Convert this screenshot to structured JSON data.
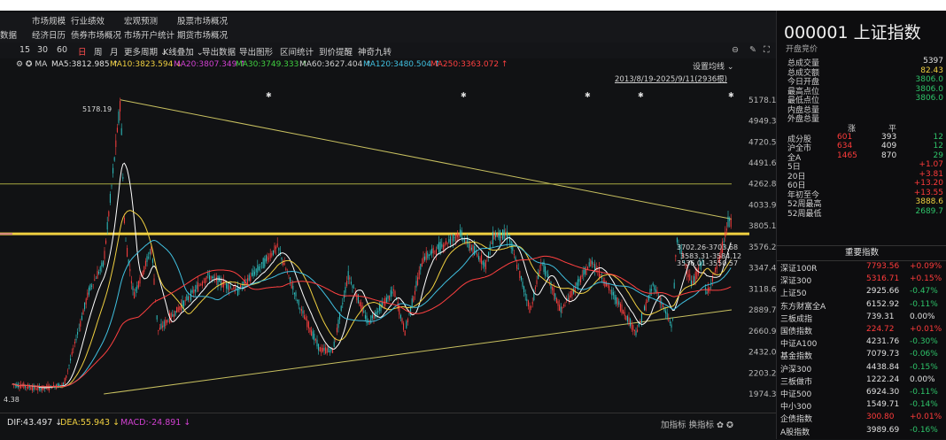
{
  "menu": {
    "row1": [
      "市场规模",
      "行业绩效",
      "宏观预测",
      "股票市场概况"
    ],
    "row2": [
      "数据",
      "经济日历",
      "债券市场概况",
      "市场开户统计",
      "期货市场概况"
    ]
  },
  "toolbar": {
    "items": [
      "15",
      "30",
      "60",
      "日",
      "周",
      "月",
      "更多周期 ⌄",
      "K线叠加 ⌄",
      "导出数据",
      "导出图形",
      "区间统计",
      "到价提醒",
      "神奇九转"
    ],
    "active_index": 3
  },
  "ma_bar": {
    "prefix": "⚙ ✪ MA",
    "items": [
      {
        "label": "MA5:3812.985 ↑",
        "color": "#e0e0e0"
      },
      {
        "label": "MA10:3823.594 ↓",
        "color": "#f0d040"
      },
      {
        "label": "MA20:3807.349 ↑",
        "color": "#d040d0"
      },
      {
        "label": "MA30:3749.333 ↑",
        "color": "#40d040"
      },
      {
        "label": "MA60:3627.404 ↑",
        "color": "#d0d0d0"
      },
      {
        "label": "MA120:3480.504 ↑",
        "color": "#40c0e0"
      },
      {
        "label": "MA250:3363.072 ↑",
        "color": "#ff4040"
      }
    ],
    "setting_label": "设置均线 ⌄"
  },
  "date_range": "2013/8/19-2025/9/11(2936根)",
  "chart_data": {
    "type": "line",
    "series_type": "candlestick",
    "y_ticks": [
      "5178.19",
      "4949.35",
      "4720.50",
      "4491.66",
      "4262.82",
      "4033.97",
      "3805.13",
      "3576.29",
      "3347.44",
      "3118.60",
      "2889.75",
      "2660.91",
      "2432.07",
      "2203.22",
      "1974.38"
    ],
    "ylim": [
      1849,
      5263
    ],
    "annotations": [
      "5178.19",
      "3702.26-3703.68",
      "3583.31-3584.12",
      "3536.01-3550.57",
      "4.38"
    ],
    "trend_lines": {
      "upper": [
        {
          "date": "2015-06-12",
          "y": 5178.19
        },
        {
          "date": "2025-09-11",
          "y": 3880
        }
      ],
      "lower": [
        {
          "date": "2015-03-02",
          "y": 1974.38
        },
        {
          "date": "2025-09-11",
          "y": 2890
        }
      ],
      "h1": 4262.82,
      "h2": 3719
    },
    "close_series_sketch": [
      {
        "date": "2013-08-19",
        "y": 2080
      },
      {
        "date": "2014-02-01",
        "y": 2030
      },
      {
        "date": "2014-07-01",
        "y": 2080
      },
      {
        "date": "2014-12-01",
        "y": 3100
      },
      {
        "date": "2015-03-01",
        "y": 3400
      },
      {
        "date": "2015-06-12",
        "y": 5170
      },
      {
        "date": "2015-07-09",
        "y": 3700
      },
      {
        "date": "2015-09-01",
        "y": 3050
      },
      {
        "date": "2015-12-20",
        "y": 3560
      },
      {
        "date": "2016-01-28",
        "y": 2660
      },
      {
        "date": "2016-06-01",
        "y": 2900
      },
      {
        "date": "2016-11-28",
        "y": 3260
      },
      {
        "date": "2017-06-01",
        "y": 3100
      },
      {
        "date": "2017-11-14",
        "y": 3420
      },
      {
        "date": "2018-01-29",
        "y": 3580
      },
      {
        "date": "2018-06-20",
        "y": 2900
      },
      {
        "date": "2018-10-18",
        "y": 2450
      },
      {
        "date": "2019-01-03",
        "y": 2450
      },
      {
        "date": "2019-04-08",
        "y": 3270
      },
      {
        "date": "2019-08-06",
        "y": 2750
      },
      {
        "date": "2020-01-14",
        "y": 3100
      },
      {
        "date": "2020-03-19",
        "y": 2650
      },
      {
        "date": "2020-07-09",
        "y": 3450
      },
      {
        "date": "2021-02-18",
        "y": 3720
      },
      {
        "date": "2021-07-27",
        "y": 3380
      },
      {
        "date": "2021-09-14",
        "y": 3710
      },
      {
        "date": "2021-12-13",
        "y": 3700
      },
      {
        "date": "2022-04-27",
        "y": 2880
      },
      {
        "date": "2022-07-05",
        "y": 3420
      },
      {
        "date": "2022-10-31",
        "y": 2880
      },
      {
        "date": "2023-05-09",
        "y": 3420
      },
      {
        "date": "2023-10-23",
        "y": 2950
      },
      {
        "date": "2024-02-05",
        "y": 2640
      },
      {
        "date": "2024-05-20",
        "y": 3170
      },
      {
        "date": "2024-09-13",
        "y": 2690
      },
      {
        "date": "2024-10-08",
        "y": 3670
      },
      {
        "date": "2025-01-13",
        "y": 3160
      },
      {
        "date": "2025-03-18",
        "y": 3440
      },
      {
        "date": "2025-04-07",
        "y": 3040
      },
      {
        "date": "2025-07-01",
        "y": 3450
      },
      {
        "date": "2025-08-25",
        "y": 3880
      },
      {
        "date": "2025-09-11",
        "y": 3806
      }
    ]
  },
  "macd": {
    "dif": "DIF:43.497 ↓",
    "dea": "DEA:55.943 ↓",
    "macd": "MACD:-24.891 ↓",
    "right_label": "加指标 换指标 ✿ ✪",
    "dif_color": "#e0e0e0",
    "dea_color": "#f0d040",
    "macd_color": "#d040d0"
  },
  "quote": {
    "title": "000001 上证指数",
    "subtitle": "开盘竞价",
    "rows": [
      {
        "label": "总成交量",
        "value": "5397",
        "color": "white"
      },
      {
        "label": "总成交额",
        "value": "82.43",
        "color": "yellow"
      },
      {
        "label": "今日开盘",
        "value": "3806.0",
        "color": "green"
      },
      {
        "label": "最高点位",
        "value": "3806.0",
        "color": "green"
      },
      {
        "label": "最低点位",
        "value": "3806.0",
        "color": "green"
      },
      {
        "label": "内盘总量",
        "value": "",
        "color": "white"
      },
      {
        "label": "外盘总量",
        "value": "",
        "color": "white"
      }
    ],
    "breadth_headers": [
      "涨",
      "平"
    ],
    "breadth": [
      {
        "label": "成分股",
        "up": "601",
        "flat": "393",
        "down": "12"
      },
      {
        "label": "沪全市",
        "up": "634",
        "flat": "409",
        "down": "12"
      },
      {
        "label": "全A",
        "up": "1465",
        "flat": "870",
        "down": "29"
      }
    ],
    "periods": [
      {
        "label": "5日",
        "value": "+1.07",
        "color": "red"
      },
      {
        "label": "20日",
        "value": "+3.81",
        "color": "red"
      },
      {
        "label": "60日",
        "value": "+13.20",
        "color": "red"
      },
      {
        "label": "年初至今",
        "value": "+13.55",
        "color": "red"
      },
      {
        "label": "52周最高",
        "value": "3888.6",
        "color": "yellow"
      },
      {
        "label": "52周最低",
        "value": "2689.7",
        "color": "green"
      }
    ]
  },
  "indices": {
    "header": "重要指数",
    "rows": [
      {
        "name": "深证100R",
        "price": "7793.56",
        "change": "+0.09%",
        "dir": "up"
      },
      {
        "name": "深证300",
        "price": "5316.71",
        "change": "+0.15%",
        "dir": "up"
      },
      {
        "name": "上证50",
        "price": "2925.66",
        "change": "-0.47%",
        "dir": "down"
      },
      {
        "name": "东方财富全A",
        "price": "6152.92",
        "change": "-0.11%",
        "dir": "down"
      },
      {
        "name": "三板成指",
        "price": "739.31",
        "change": "0.00%",
        "dir": "flat"
      },
      {
        "name": "国债指数",
        "price": "224.72",
        "change": "+0.01%",
        "dir": "up"
      },
      {
        "name": "中证A100",
        "price": "4231.76",
        "change": "-0.30%",
        "dir": "down"
      },
      {
        "name": "基金指数",
        "price": "7079.73",
        "change": "-0.06%",
        "dir": "down"
      },
      {
        "name": "沪深300",
        "price": "4438.84",
        "change": "-0.15%",
        "dir": "down"
      },
      {
        "name": "三板做市",
        "price": "1222.24",
        "change": "0.00%",
        "dir": "flat"
      },
      {
        "name": "中证500",
        "price": "6924.30",
        "change": "-0.11%",
        "dir": "down"
      },
      {
        "name": "中小300",
        "price": "1549.71",
        "change": "-0.14%",
        "dir": "down"
      },
      {
        "name": "企债指数",
        "price": "300.80",
        "change": "+0.01%",
        "dir": "up"
      },
      {
        "name": "A股指数",
        "price": "3989.69",
        "change": "-0.16%",
        "dir": "down"
      }
    ]
  }
}
